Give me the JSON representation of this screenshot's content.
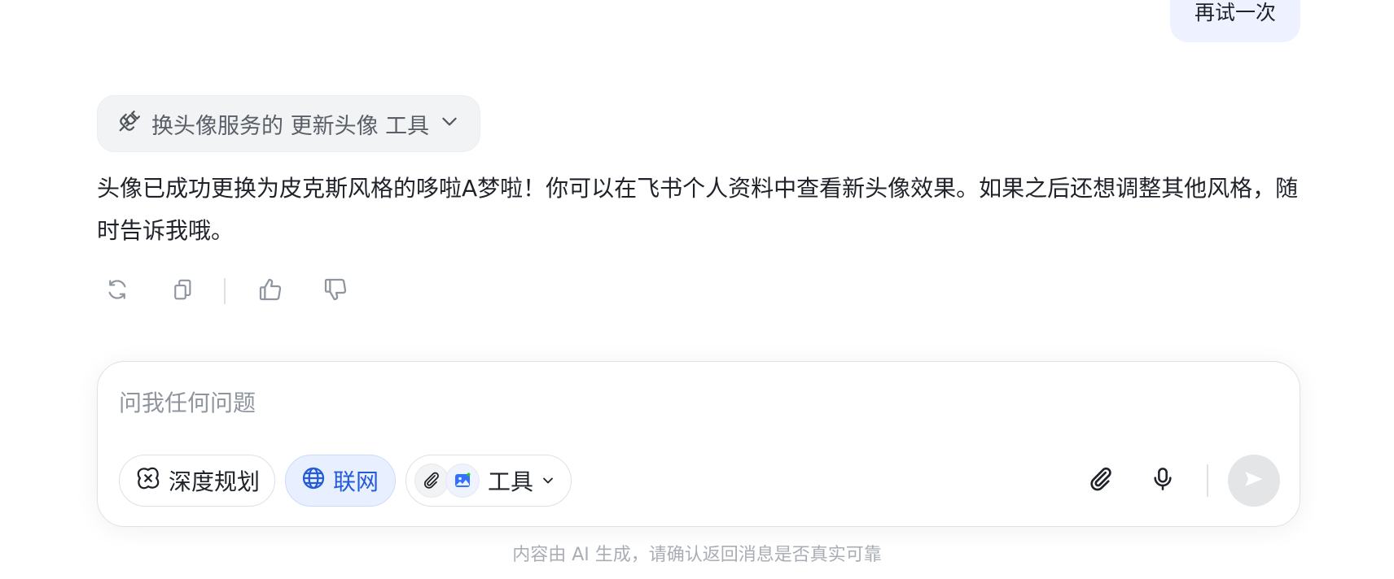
{
  "user_message": {
    "text": "再试一次"
  },
  "tool_call": {
    "label": "换头像服务的 更新头像 工具",
    "icon": "plug-icon"
  },
  "assistant_message": {
    "text": "头像已成功更换为皮克斯风格的哆啦A梦啦！你可以在飞书个人资料中查看新头像效果。如果之后还想调整其他风格，随时告诉我哦。"
  },
  "message_actions": [
    {
      "name": "regenerate",
      "icon": "refresh-icon"
    },
    {
      "name": "copy",
      "icon": "copy-icon"
    },
    {
      "name": "like",
      "icon": "thumbs-up-icon"
    },
    {
      "name": "dislike",
      "icon": "thumbs-down-icon"
    }
  ],
  "composer": {
    "placeholder": "问我任何问题",
    "value": "",
    "deep_plan_label": "深度规划",
    "web_label": "联网",
    "tools_label": "工具",
    "web_active": true,
    "accent_color": "#245bdb",
    "send_enabled": false
  },
  "disclaimer": "内容由 AI 生成，请确认返回消息是否真实可靠"
}
